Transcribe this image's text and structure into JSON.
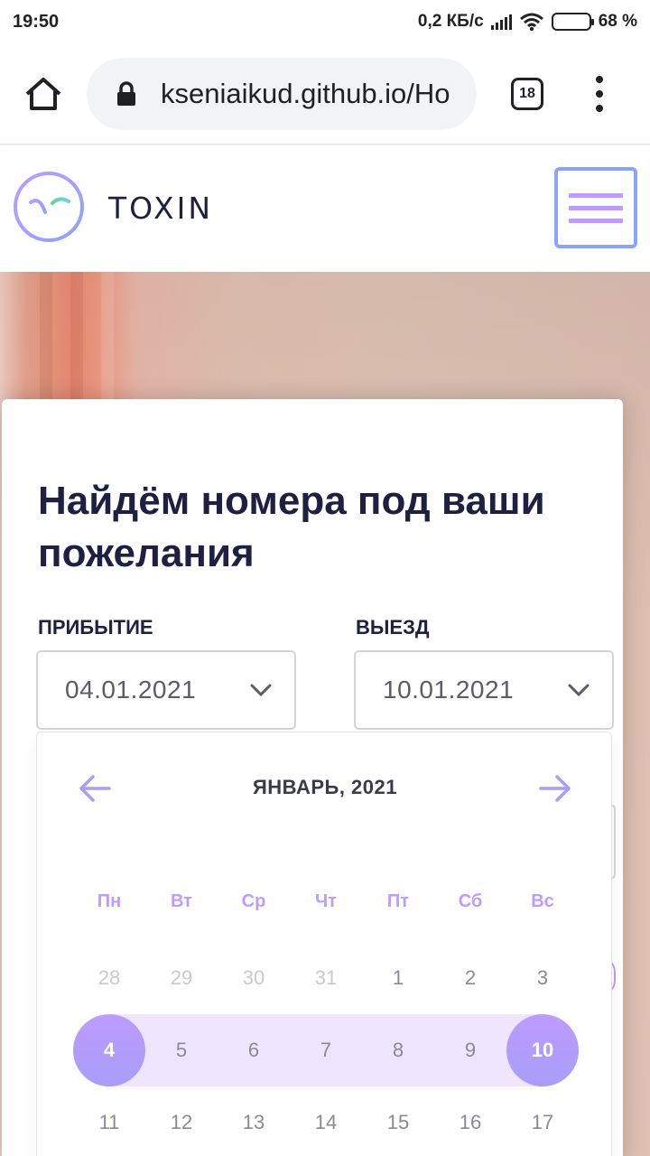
{
  "status_bar": {
    "time": "19:50",
    "speed": "0,2 КБ/с",
    "battery": "68 %",
    "battery_level": 0.68
  },
  "browser": {
    "url": "kseniaikud.github.io/Ho",
    "tab_count": "18",
    "icons": [
      "home-icon",
      "lock-icon",
      "tabs-icon",
      "more-vert-icon"
    ]
  },
  "header": {
    "logo_text": "TOXIN",
    "menu_icon": "hamburger-icon"
  },
  "card": {
    "title": "Найдём номера под ваши пожелания",
    "arrival_label": "прибытие",
    "arrival_value": "04.01.2021",
    "departure_label": "выезд",
    "departure_value": "10.01.2021"
  },
  "calendar": {
    "month": "ЯНВАРЬ, 2021",
    "weekdays": [
      "Пн",
      "Вт",
      "Ср",
      "Чт",
      "Пт",
      "Сб",
      "Вс"
    ],
    "weeks": [
      [
        "28",
        "29",
        "30",
        "31",
        "1",
        "2",
        "3"
      ],
      [
        "4",
        "5",
        "6",
        "7",
        "8",
        "9",
        "10"
      ],
      [
        "11",
        "12",
        "13",
        "14",
        "15",
        "16",
        "17"
      ]
    ],
    "range_start": "4",
    "range_end": "10"
  },
  "colors": {
    "accent": "#bc9cff",
    "accent_alt": "#8ba4f9",
    "range_bg": "#efe5ff",
    "dark": "#1f2041"
  }
}
